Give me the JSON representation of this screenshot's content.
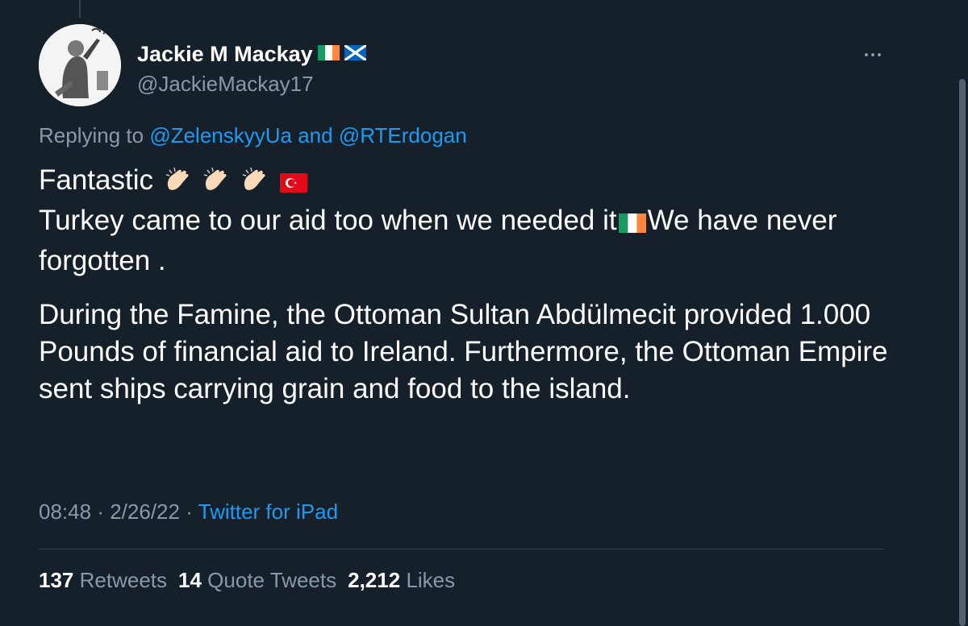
{
  "author": {
    "display_name": "Jackie M Mackay",
    "handle": "@JackieMackay17",
    "name_flags": [
      "ireland-flag-icon",
      "scotland-flag-icon"
    ]
  },
  "reply": {
    "prefix": "Replying to",
    "mention1": "@ZelenskyyUa",
    "joiner": "and",
    "mention2": "@RTErdogan"
  },
  "tweet": {
    "line1": "Fantastic",
    "line2a": "Turkey came to our aid too when we needed it",
    "line2b": "We have never forgotten .",
    "para2": "During the Famine, the Ottoman Sultan Abdülmecit provided 1.000 Pounds of financial aid to Ireland. Furthermore, the Ottoman Empire sent ships carrying grain and food to the island."
  },
  "meta": {
    "time": "08:48",
    "sep1": "·",
    "date": "2/26/22",
    "sep2": "·",
    "source": "Twitter for iPad"
  },
  "stats": {
    "retweets_count": "137",
    "retweets_label": "Retweets",
    "quotes_count": "14",
    "quotes_label": "Quote Tweets",
    "likes_count": "2,212",
    "likes_label": "Likes"
  },
  "colors": {
    "background": "#15202b",
    "link": "#1d9bf0",
    "muted": "#8b98a5"
  }
}
